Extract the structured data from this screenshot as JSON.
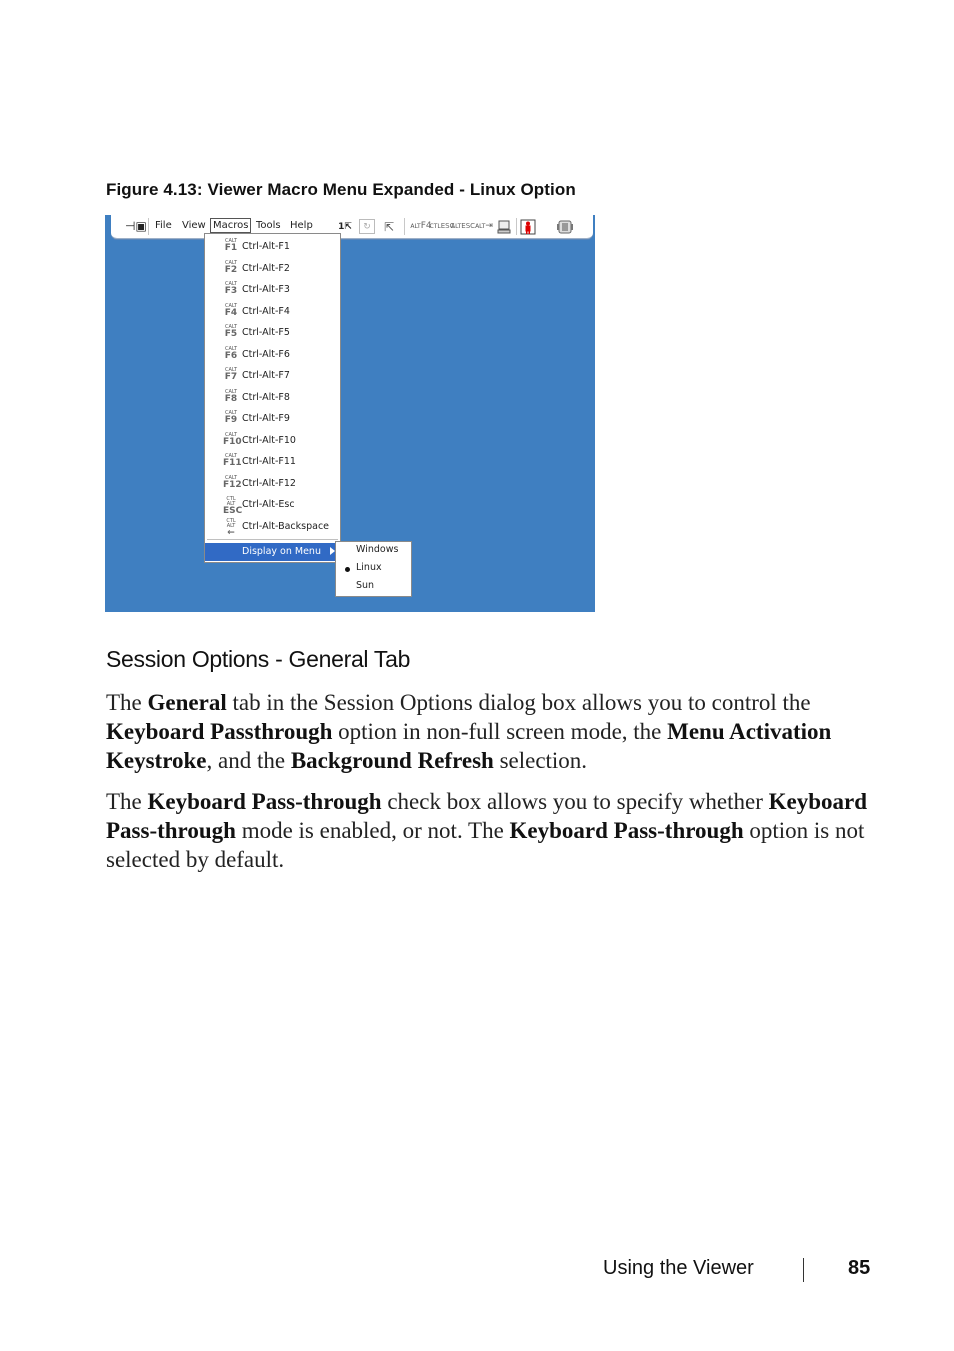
{
  "figure": {
    "caption": "Figure 4.13: Viewer Macro Menu Expanded - Linux Option",
    "toolbar": {
      "pin_icon": "pin-icon",
      "menus": [
        "File",
        "View",
        "Macros",
        "Tools",
        "Help"
      ],
      "active_menu": "Macros",
      "icons": [
        {
          "name": "single-cursor-icon",
          "glyph": "1⇱"
        },
        {
          "name": "refresh-icon",
          "glyph": "↻"
        },
        {
          "name": "align-cursor-icon",
          "glyph": "⇱"
        }
      ],
      "key_buttons": [
        {
          "top": "ALT",
          "bottom": "F4"
        },
        {
          "top": "CTL",
          "bottom": "ESC"
        },
        {
          "top": "ALT",
          "bottom": "ESC"
        },
        {
          "top": "ALT",
          "bottom": "⇥"
        }
      ],
      "extra_icons": [
        "computer-icon",
        "person-icon",
        "battery-icon"
      ]
    },
    "macros_menu": {
      "items": [
        {
          "icon_top": "CALT",
          "icon_bottom": "F1",
          "label": "Ctrl-Alt-F1"
        },
        {
          "icon_top": "CALT",
          "icon_bottom": "F2",
          "label": "Ctrl-Alt-F2"
        },
        {
          "icon_top": "CALT",
          "icon_bottom": "F3",
          "label": "Ctrl-Alt-F3"
        },
        {
          "icon_top": "CALT",
          "icon_bottom": "F4",
          "label": "Ctrl-Alt-F4"
        },
        {
          "icon_top": "CALT",
          "icon_bottom": "F5",
          "label": "Ctrl-Alt-F5"
        },
        {
          "icon_top": "CALT",
          "icon_bottom": "F6",
          "label": "Ctrl-Alt-F6"
        },
        {
          "icon_top": "CALT",
          "icon_bottom": "F7",
          "label": "Ctrl-Alt-F7"
        },
        {
          "icon_top": "CALT",
          "icon_bottom": "F8",
          "label": "Ctrl-Alt-F8"
        },
        {
          "icon_top": "CALT",
          "icon_bottom": "F9",
          "label": "Ctrl-Alt-F9"
        },
        {
          "icon_top": "CALT",
          "icon_bottom": "F10",
          "label": "Ctrl-Alt-F10"
        },
        {
          "icon_top": "CALT",
          "icon_bottom": "F11",
          "label": "Ctrl-Alt-F11"
        },
        {
          "icon_top": "CALT",
          "icon_bottom": "F12",
          "label": "Ctrl-Alt-F12"
        },
        {
          "icon_top": "CTL ALT",
          "icon_bottom": "ESC",
          "label": "Ctrl-Alt-Esc"
        },
        {
          "icon_top": "CTL ALT",
          "icon_bottom": "←",
          "label": "Ctrl-Alt-Backspace"
        }
      ],
      "display_on_menu": "Display on Menu"
    },
    "submenu": {
      "items": [
        "Windows",
        "Linux",
        "Sun"
      ],
      "selected": "Linux"
    },
    "colors": {
      "desktop": "#3f7fc1",
      "highlight": "#316ac5"
    }
  },
  "section": {
    "heading": "Session Options - General Tab",
    "p1": {
      "t1": "The ",
      "b1": "General",
      "t2": " tab in the Session Options dialog box allows you to control the ",
      "b2": "Keyboard Passthrough",
      "t3": " option in non-full screen mode, the ",
      "b3": "Menu Activation Keystroke",
      "t4": ", and the ",
      "b4": "Background Refresh",
      "t5": " selection."
    },
    "p2": {
      "t1": "The ",
      "b1": "Keyboard Pass-through",
      "t2": " check box allows you to specify whether ",
      "b2": "Keyboard Pass-through",
      "t3": " mode is enabled, or not. The ",
      "b3": "Keyboard Pass-through",
      "t4": " option is not selected by default."
    }
  },
  "footer": {
    "chapter": "Using the Viewer",
    "page": "85"
  }
}
